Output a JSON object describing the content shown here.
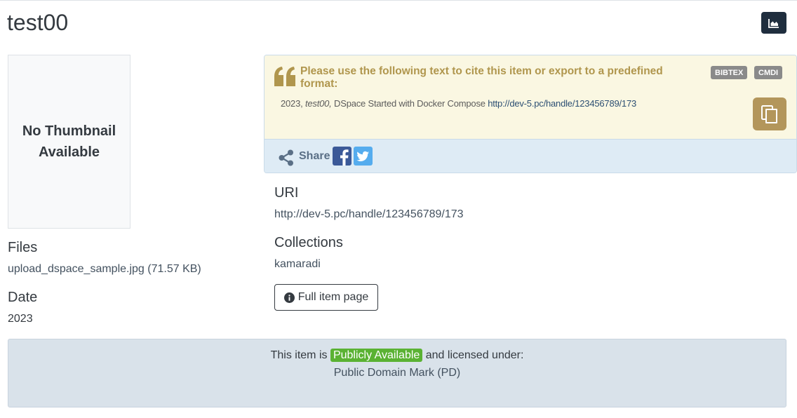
{
  "page": {
    "title": "test00"
  },
  "thumbnail": {
    "text": "No Thumbnail Available"
  },
  "files": {
    "label": "Files",
    "link": "upload_dspace_sample.jpg (71.57 KB)"
  },
  "date": {
    "label": "Date",
    "value": "2023"
  },
  "citation": {
    "heading": "Please use the following text to cite this item or export to a predefined format:",
    "badges": [
      "BIBTEX",
      "CMDI"
    ],
    "year": "2023,",
    "item_title": "test00,",
    "rest": "DSpace Started with Docker Compose",
    "url": "http://dev-5.pc/handle/123456789/173"
  },
  "share": {
    "label": "Share"
  },
  "uri": {
    "label": "URI",
    "link": "http://dev-5.pc/handle/123456789/173"
  },
  "collections": {
    "label": "Collections",
    "link": "kamaradi"
  },
  "full_item": {
    "label": "Full item page"
  },
  "license": {
    "prefix": "This item is",
    "badge": "Publicly Available",
    "suffix": "and licensed under:",
    "link": "Public Domain Mark (PD)"
  },
  "colors": {
    "accent_gold": "#b3965b",
    "cite_bg": "#faf7e2",
    "share_bg": "#deebf5",
    "license_bg": "#d9e2ea",
    "publicly_available": "#5ab233",
    "stats_button": "#1f2e3e"
  },
  "icons": [
    "chart-area-icon",
    "quote-left-icon",
    "copy-icon",
    "share-alt-icon",
    "facebook-icon",
    "twitter-icon",
    "info-circle-icon"
  ]
}
